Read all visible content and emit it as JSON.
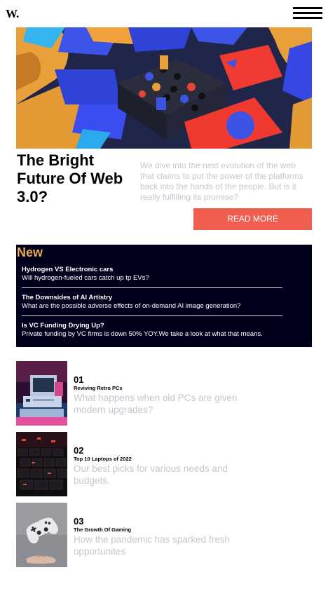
{
  "header": {
    "logo": "W.",
    "menu_icon": "hamburger-menu-icon"
  },
  "featured": {
    "title": "The Bright Future Of Web 3.0?",
    "summary": "We dive into the next evolution of the web that claims to put the power of the platforms back into the hands of the people. But is it really fulfilling its promise?",
    "button": "READ MORE"
  },
  "new_section": {
    "heading": "New",
    "items": [
      {
        "title": "Hydrogen VS Electronic cars",
        "description": "Will hydrogen-fueled cars catch up tp EVs?"
      },
      {
        "title": "The Downsides of AI Artistry",
        "description": "What are the possible adverse effects of on-demand AI image generation?"
      },
      {
        "title": "Is VC Funding Drying Up?",
        "description": "Private funding by VC firms is down 50% YOY.We take a look at what that means."
      }
    ]
  },
  "articles": [
    {
      "number": "01",
      "title": "Reviving Retro PCs",
      "description": "What happens when old PCs are given modern upgrades?"
    },
    {
      "number": "02",
      "title": "Top 10 Laptops of 2022",
      "description": "Our best picks for various needs and budgets."
    },
    {
      "number": "03",
      "title": "The Growth Of Gaming",
      "description": "How the pandemic has sparked fresh opportunites"
    }
  ],
  "colors": {
    "accent": "#f15e50",
    "new_heading": "#e9ab53",
    "new_bg": "#00001d",
    "muted_text": "#c5c6d0"
  }
}
